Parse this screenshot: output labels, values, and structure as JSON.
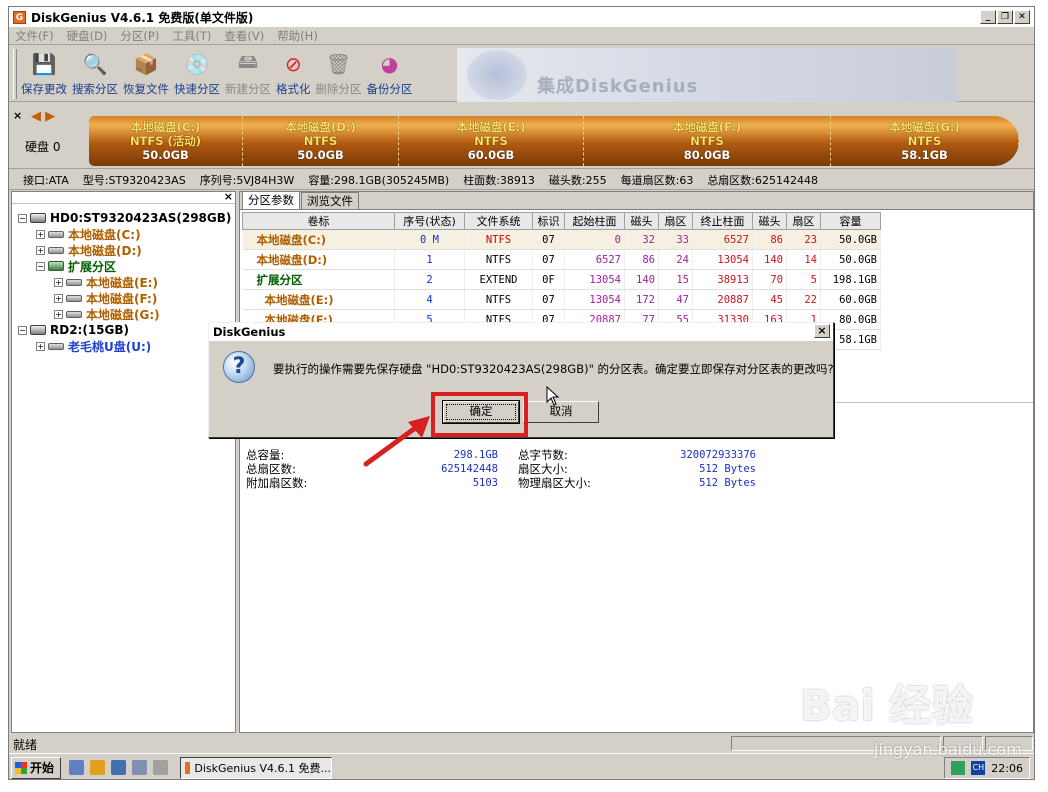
{
  "window": {
    "title": "DiskGenius V4.6.1 免费版(单文件版)"
  },
  "menu": [
    "文件(F)",
    "硬盘(D)",
    "分区(P)",
    "工具(T)",
    "查看(V)",
    "帮助(H)"
  ],
  "toolbar": [
    {
      "label": "保存更改",
      "icon": "save-icon",
      "disabled": false
    },
    {
      "label": "搜索分区",
      "icon": "magnifier-icon",
      "disabled": false
    },
    {
      "label": "恢复文件",
      "icon": "recover-icon",
      "disabled": false
    },
    {
      "label": "快速分区",
      "icon": "quick-partition-icon",
      "disabled": false
    },
    {
      "label": "新建分区",
      "icon": "new-partition-icon",
      "disabled": true
    },
    {
      "label": "格式化",
      "icon": "format-icon",
      "disabled": false
    },
    {
      "label": "删除分区",
      "icon": "trash-icon",
      "disabled": true
    },
    {
      "label": "备份分区",
      "icon": "backup-icon",
      "disabled": false
    }
  ],
  "banner_text": "集成DiskGenius",
  "disk_bar": {
    "label": "硬盘 0",
    "segments": [
      {
        "name": "本地磁盘(C:)",
        "fs": "NTFS (活动)",
        "size": "50.0GB"
      },
      {
        "name": "本地磁盘(D:)",
        "fs": "NTFS",
        "size": "50.0GB"
      },
      {
        "name": "本地磁盘(E:)",
        "fs": "NTFS",
        "size": "60.0GB"
      },
      {
        "name": "本地磁盘(F:)",
        "fs": "NTFS",
        "size": "80.0GB"
      },
      {
        "name": "本地磁盘(G:)",
        "fs": "NTFS",
        "size": "58.1GB"
      }
    ]
  },
  "info_bar": [
    "接口:ATA",
    "型号:ST9320423AS",
    "序列号:5VJ84H3W",
    "容量:298.1GB(305245MB)",
    "柱面数:38913",
    "磁头数:255",
    "每道扇区数:63",
    "总扇区数:625142448"
  ],
  "tree": [
    {
      "text": "HD0:ST9320423AS(298GB)",
      "level": 0,
      "exp": "−",
      "icon": "hd",
      "color": ""
    },
    {
      "text": "本地磁盘(C:)",
      "level": 1,
      "exp": "+",
      "icon": "part",
      "color": "brown"
    },
    {
      "text": "本地磁盘(D:)",
      "level": 1,
      "exp": "+",
      "icon": "part",
      "color": "brown"
    },
    {
      "text": "扩展分区",
      "level": 1,
      "exp": "−",
      "icon": "ext",
      "color": "green"
    },
    {
      "text": "本地磁盘(E:)",
      "level": 2,
      "exp": "+",
      "icon": "part",
      "color": "brown"
    },
    {
      "text": "本地磁盘(F:)",
      "level": 2,
      "exp": "+",
      "icon": "part",
      "color": "brown"
    },
    {
      "text": "本地磁盘(G:)",
      "level": 2,
      "exp": "+",
      "icon": "part",
      "color": "brown"
    },
    {
      "text": "RD2:(15GB)",
      "level": 0,
      "exp": "−",
      "icon": "hd",
      "color": ""
    },
    {
      "text": "老毛桃U盘(U:)",
      "level": 1,
      "exp": "+",
      "icon": "part",
      "color": "blue"
    }
  ],
  "tabs": [
    "分区参数",
    "浏览文件"
  ],
  "table": {
    "headers": [
      "卷标",
      "序号(状态)",
      "文件系统",
      "标识",
      "起始柱面",
      "磁头",
      "扇区",
      "终止柱面",
      "磁头",
      "扇区",
      "容量"
    ],
    "rows": [
      [
        "本地磁盘(C:)",
        "0 M",
        "NTFS",
        "07",
        "0",
        "32",
        "33",
        "6527",
        "86",
        "23",
        "50.0GB"
      ],
      [
        "本地磁盘(D:)",
        "1",
        "NTFS",
        "07",
        "6527",
        "86",
        "24",
        "13054",
        "140",
        "14",
        "50.0GB"
      ],
      [
        "扩展分区",
        "2",
        "EXTEND",
        "0F",
        "13054",
        "140",
        "15",
        "38913",
        "70",
        "5",
        "198.1GB"
      ],
      [
        "本地磁盘(E:)",
        "4",
        "NTFS",
        "07",
        "13054",
        "172",
        "47",
        "20887",
        "45",
        "22",
        "60.0GB"
      ],
      [
        "本地磁盘(F:)",
        "5",
        "NTFS",
        "07",
        "20887",
        "77",
        "55",
        "31330",
        "163",
        "1",
        "80.0GB"
      ],
      [
        "",
        "",
        "",
        "",
        "",
        "",
        "",
        "",
        "",
        "",
        "58.1GB"
      ]
    ]
  },
  "disk_info": {
    "left": [
      [
        "总容量:",
        "298.1GB"
      ],
      [
        "总扇区数:",
        "625142448"
      ],
      [
        "附加扇区数:",
        "5103"
      ]
    ],
    "right": [
      [
        "总字节数:",
        "320072933376"
      ],
      [
        "扇区大小:",
        "512 Bytes"
      ],
      [
        "物理扇区大小:",
        "512 Bytes"
      ]
    ]
  },
  "status": "就绪",
  "taskbar": {
    "start": "开始",
    "task": "DiskGenius V4.6.1 免费...",
    "tray_lang": "CH",
    "time": "22:06"
  },
  "dialog": {
    "title": "DiskGenius",
    "message": "要执行的操作需要先保存硬盘 \"HD0:ST9320423AS(298GB)\" 的分区表。确定要立即保存对分区表的更改吗?",
    "ok": "确定",
    "cancel": "取消"
  },
  "watermark": {
    "logo": "Bai 经验",
    "url": "jingyan.baidu.com"
  },
  "colors": {
    "highlight": "#d82020",
    "partition_name": "#b06000",
    "extended": "#006000",
    "usb": "#2040d0"
  }
}
